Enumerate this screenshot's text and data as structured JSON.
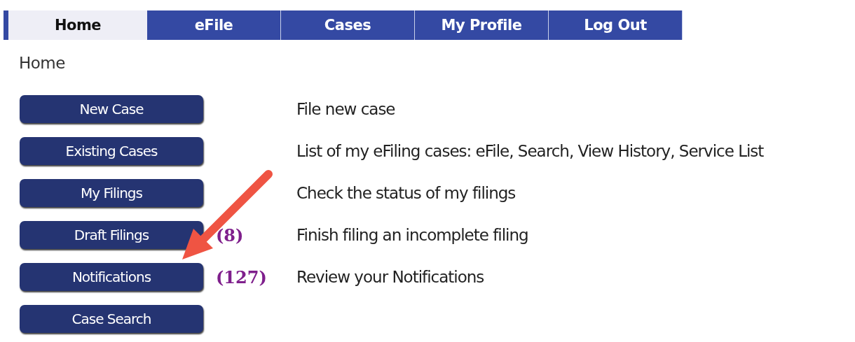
{
  "tabs": [
    {
      "label": "Home",
      "selected": true
    },
    {
      "label": "eFile",
      "selected": false
    },
    {
      "label": "Cases",
      "selected": false
    },
    {
      "label": "My Profile",
      "selected": false
    },
    {
      "label": "Log Out",
      "selected": false
    }
  ],
  "breadcrumb": "Home",
  "actions": [
    {
      "button": "New Case",
      "description": "File new case"
    },
    {
      "button": "Existing Cases",
      "description": "List of my eFiling cases: eFile, Search, View History, Service List"
    },
    {
      "button": "My Filings",
      "description": "Check the status of my filings"
    },
    {
      "button": "Draft Filings",
      "count": "(8)",
      "description": "Finish filing an incomplete filing"
    },
    {
      "button": "Notifications",
      "count": "(127)",
      "description": "Review your Notifications"
    },
    {
      "button": "Case Search"
    }
  ]
}
